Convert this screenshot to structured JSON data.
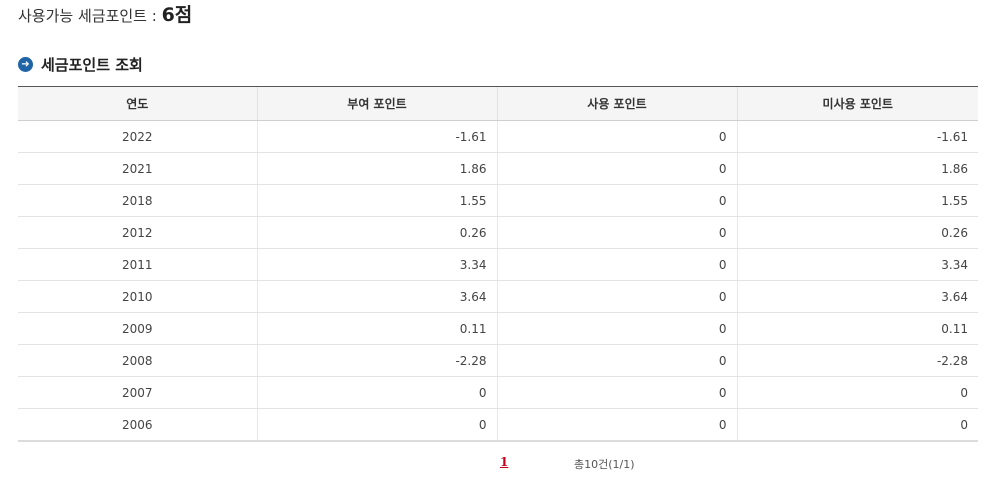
{
  "summary": {
    "label": "사용가능 세금포인트 : ",
    "points": "6점"
  },
  "section": {
    "title": "세금포인트 조회"
  },
  "table": {
    "headers": [
      "연도",
      "부여 포인트",
      "사용 포인트",
      "미사용 포인트"
    ],
    "rows": [
      [
        "2022",
        "-1.61",
        "0",
        "-1.61"
      ],
      [
        "2021",
        "1.86",
        "0",
        "1.86"
      ],
      [
        "2018",
        "1.55",
        "0",
        "1.55"
      ],
      [
        "2012",
        "0.26",
        "0",
        "0.26"
      ],
      [
        "2011",
        "3.34",
        "0",
        "3.34"
      ],
      [
        "2010",
        "3.64",
        "0",
        "3.64"
      ],
      [
        "2009",
        "0.11",
        "0",
        "0.11"
      ],
      [
        "2008",
        "-2.28",
        "0",
        "-2.28"
      ],
      [
        "2007",
        "0",
        "0",
        "0"
      ],
      [
        "2006",
        "0",
        "0",
        "0"
      ]
    ]
  },
  "pager": {
    "current": "1",
    "total": "총10건(1/1)"
  },
  "colors": {
    "accent": "#1f64a6",
    "page_link": "#c0001c"
  }
}
